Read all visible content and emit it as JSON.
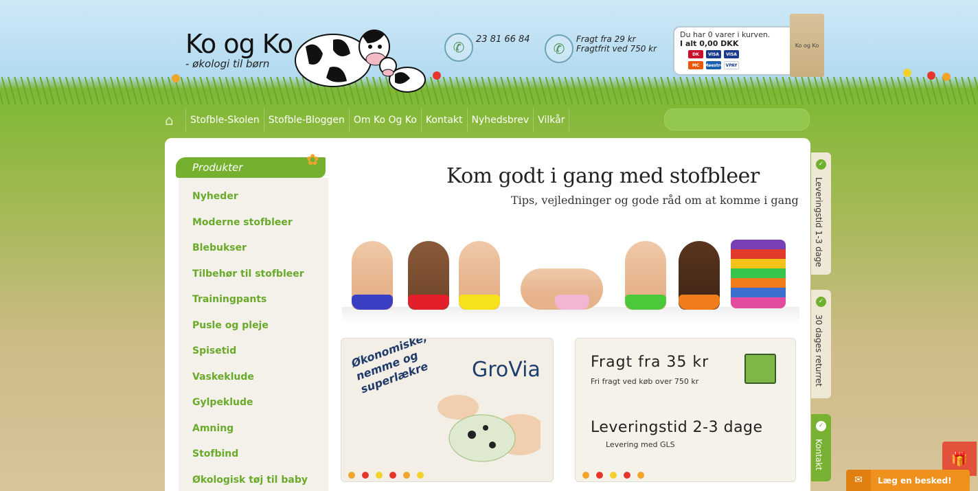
{
  "header": {
    "logo_title": "Ko og Ko",
    "logo_subtitle": "- økologi til børn",
    "phone": "23 81 66 84",
    "shipping_line1": "Fragt fra 29 kr",
    "shipping_line2": "Fragtfrit ved 750 kr"
  },
  "cart": {
    "status": "Du har 0 varer i kurven.",
    "total": "I alt 0,00 DKK",
    "bag_label": "Ko og Ko",
    "cards": [
      "DK",
      "VISA",
      "VISA",
      "MC",
      "Maestro",
      "VPAY"
    ]
  },
  "nav": {
    "items": [
      "Stofble-Skolen",
      "Stofble-Bloggen",
      "Om Ko Og Ko",
      "Kontakt",
      "Nyhedsbrev",
      "Vilkår"
    ],
    "search_placeholder": ""
  },
  "sidebar": {
    "heading": "Produkter",
    "items": [
      "Nyheder",
      "Moderne stofbleer",
      "Blebukser",
      "Tilbehør til stofbleer",
      "Trainingpants",
      "Pusle og pleje",
      "Spisetid",
      "Vaskeklude",
      "Gylpeklude",
      "Amning",
      "Stofbind",
      "Økologisk tøj til baby"
    ]
  },
  "banner": {
    "title": "Kom godt i gang med stofbleer",
    "subtitle": "Tips, vejledninger og gode råd om at komme i gang"
  },
  "promo_grovia": {
    "brand": "GroVia",
    "slogan_line1": "Økonomiske,",
    "slogan_line2": "nemme og",
    "slogan_line3": "superlækre"
  },
  "promo_shipping": {
    "title": "Fragt fra 35 kr",
    "subtitle": "Fri fragt ved køb over 750 kr",
    "delivery_title": "Leveringstid 2-3 dage",
    "delivery_subtitle": "Levering med GLS"
  },
  "side_tabs": {
    "tab1": "Leveringstid 1-3 dage",
    "tab2": "30 dages returret",
    "tab3": "Kontakt"
  },
  "chat": {
    "label": "Læg en besked!"
  },
  "colors": {
    "brand_green": "#76b02f",
    "link_green": "#6aaa2a",
    "chat_orange": "#f0911e",
    "gift_red": "#e2523a"
  }
}
